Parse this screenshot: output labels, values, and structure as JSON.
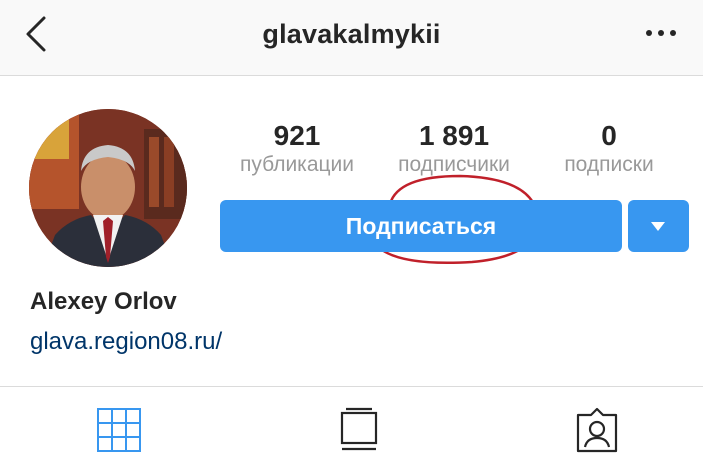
{
  "header": {
    "username": "glavakalmykii",
    "back_icon": "chevron-left-icon",
    "more_icon": "more-horizontal-icon"
  },
  "profile": {
    "avatar_icon": "profile-photo",
    "stats": {
      "posts": {
        "value": "921",
        "label": "публикации"
      },
      "followers": {
        "value": "1 891",
        "label": "подписчики"
      },
      "following": {
        "value": "0",
        "label": "подписки"
      }
    },
    "follow_button_label": "Подписаться",
    "full_name": "Alexey Orlov",
    "website": "glava.region08.ru/"
  },
  "tabs": [
    {
      "icon": "grid-icon",
      "active": true
    },
    {
      "icon": "feed-icon",
      "active": false
    },
    {
      "icon": "tagged-icon",
      "active": false
    }
  ],
  "colors": {
    "accent": "#3897f0",
    "link": "#003569",
    "highlight_annotation": "#c0202a",
    "active_tab": "#3897f0",
    "inactive_tab": "#262626"
  }
}
